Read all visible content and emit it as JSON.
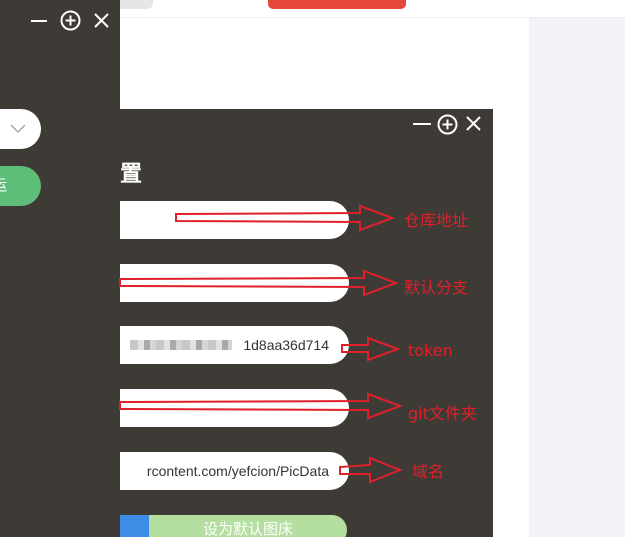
{
  "background_page": {
    "accent_color": "#e5483a"
  },
  "back_window": {
    "controls": [
      "minimize-icon",
      "maximize-icon",
      "close-icon"
    ],
    "button_label": "运"
  },
  "settings_window": {
    "title": "置",
    "controls": [
      "minimize-icon",
      "maximize-icon",
      "close-icon"
    ],
    "fields": [
      {
        "name": "repo",
        "value": ""
      },
      {
        "name": "branch",
        "value": ""
      },
      {
        "name": "token",
        "value": "1d8aa36d714"
      },
      {
        "name": "folder",
        "value": ""
      },
      {
        "name": "domain",
        "value": "rcontent.com/yefcion/PicData"
      }
    ],
    "default_button_label": "设为默认图床"
  },
  "annotations": {
    "color": "#e0202a",
    "labels": [
      "仓库地址",
      "默认分支",
      "token",
      "git文件夹",
      "域名"
    ]
  }
}
